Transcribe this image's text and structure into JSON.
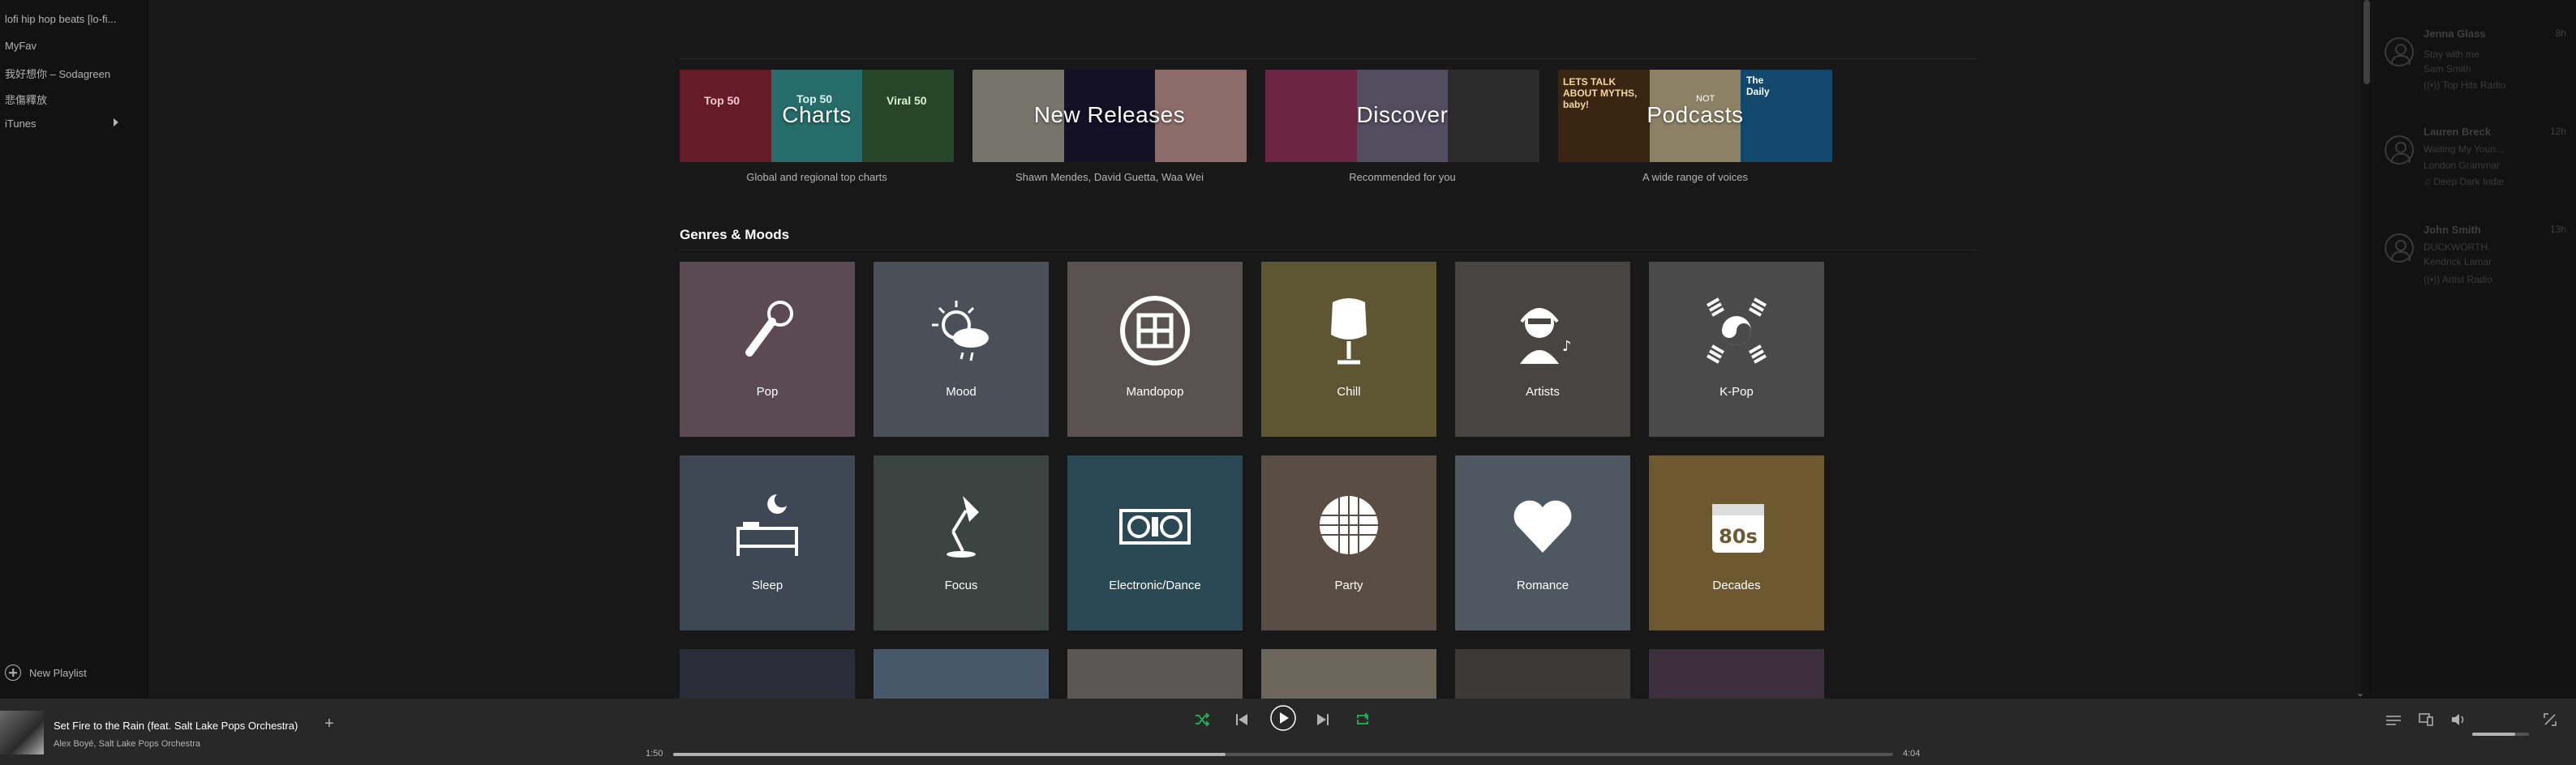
{
  "sidebar": {
    "playlists": [
      {
        "label": "lofi hip hop beats [lo-fi..."
      },
      {
        "label": "MyFav"
      },
      {
        "label": "我好想你 – Sodagreen"
      },
      {
        "label": "悲傷釋放"
      },
      {
        "label": "iTunes"
      }
    ],
    "new_playlist_label": "New Playlist"
  },
  "browse": {
    "cards": [
      {
        "title": "Charts",
        "subtitle": "Global and regional top charts",
        "tile_labels": [
          "Top 50",
          "Top 50",
          "Viral 50"
        ],
        "colors": [
          "#9d2a3f",
          "#3aa7a3",
          "#3b6b3f"
        ]
      },
      {
        "title": "New Releases",
        "subtitle": "Shawn Mendes, David Guetta, Waa Wei",
        "tile_labels": [],
        "colors": [
          "#b7b2a6",
          "#201a3b",
          "#d7a5a0"
        ]
      },
      {
        "title": "Discover",
        "subtitle": "Recommended for you",
        "tile_labels": [],
        "colors": [
          "#a73a6a",
          "#7f7894",
          "#444444"
        ]
      },
      {
        "title": "Podcasts",
        "subtitle": "A wide range of voices",
        "tile_labels": [
          "LETS TALK ABOUT MYTHS, baby!",
          "NOT",
          "The Daily"
        ],
        "colors": [
          "#5a3a1c",
          "#d8c79a",
          "#1c6fa5"
        ]
      }
    ]
  },
  "genres": {
    "heading": "Genres & Moods",
    "items": [
      {
        "label": "Pop",
        "icon": "microphone-icon",
        "color": "#5b4a52"
      },
      {
        "label": "Mood",
        "icon": "weather-icon",
        "color": "#4a4f58"
      },
      {
        "label": "Mandopop",
        "icon": "chinese-knot-icon",
        "color": "#5a5250"
      },
      {
        "label": "Chill",
        "icon": "egg-chair-icon",
        "color": "#5e5533"
      },
      {
        "label": "Artists",
        "icon": "artist-headphones-icon",
        "color": "#474443"
      },
      {
        "label": "K-Pop",
        "icon": "korean-flag-icon",
        "color": "#4a4a4a"
      },
      {
        "label": "Sleep",
        "icon": "bed-icon",
        "color": "#3e4754"
      },
      {
        "label": "Focus",
        "icon": "desk-lamp-icon",
        "color": "#3c4442"
      },
      {
        "label": "Electronic/Dance",
        "icon": "turntable-icon",
        "color": "#2b4954"
      },
      {
        "label": "Party",
        "icon": "disco-ball-icon",
        "color": "#5a4d43"
      },
      {
        "label": "Romance",
        "icon": "heart-icon",
        "color": "#4f5860"
      },
      {
        "label": "Decades",
        "icon": "calendar-80s-icon",
        "color": "#6e5830"
      }
    ],
    "partial_row_colors": [
      "#2b2e3a",
      "#46586a",
      "#5a5754",
      "#6b655a",
      "#3c3a38",
      "#3d2f3e"
    ]
  },
  "friends": [
    {
      "name": "Jenna Glass",
      "time": "8h",
      "track": "Stay with me",
      "artist": "Sam Smith",
      "context": "Top Hits Radio"
    },
    {
      "name": "Lauren Breck",
      "time": "12h",
      "track": "Waiting My Youn...",
      "artist": "London Grammar",
      "context": "Deep Dark Indie"
    },
    {
      "name": "John Smith",
      "time": "13h",
      "track": "DUCKWORTH.",
      "artist": "Kendrick Lamar",
      "context": "Artist Radio"
    }
  ],
  "player": {
    "track_title": "Set Fire to the Rain (feat. Salt Lake Pops Orchestra)",
    "track_artist": "Alex Boyé, Salt Lake Pops Orchestra",
    "elapsed": "1:50",
    "duration": "4:04",
    "progress_fraction": 0.453,
    "volume_fraction": 0.75,
    "accent_color": "#1db954"
  }
}
